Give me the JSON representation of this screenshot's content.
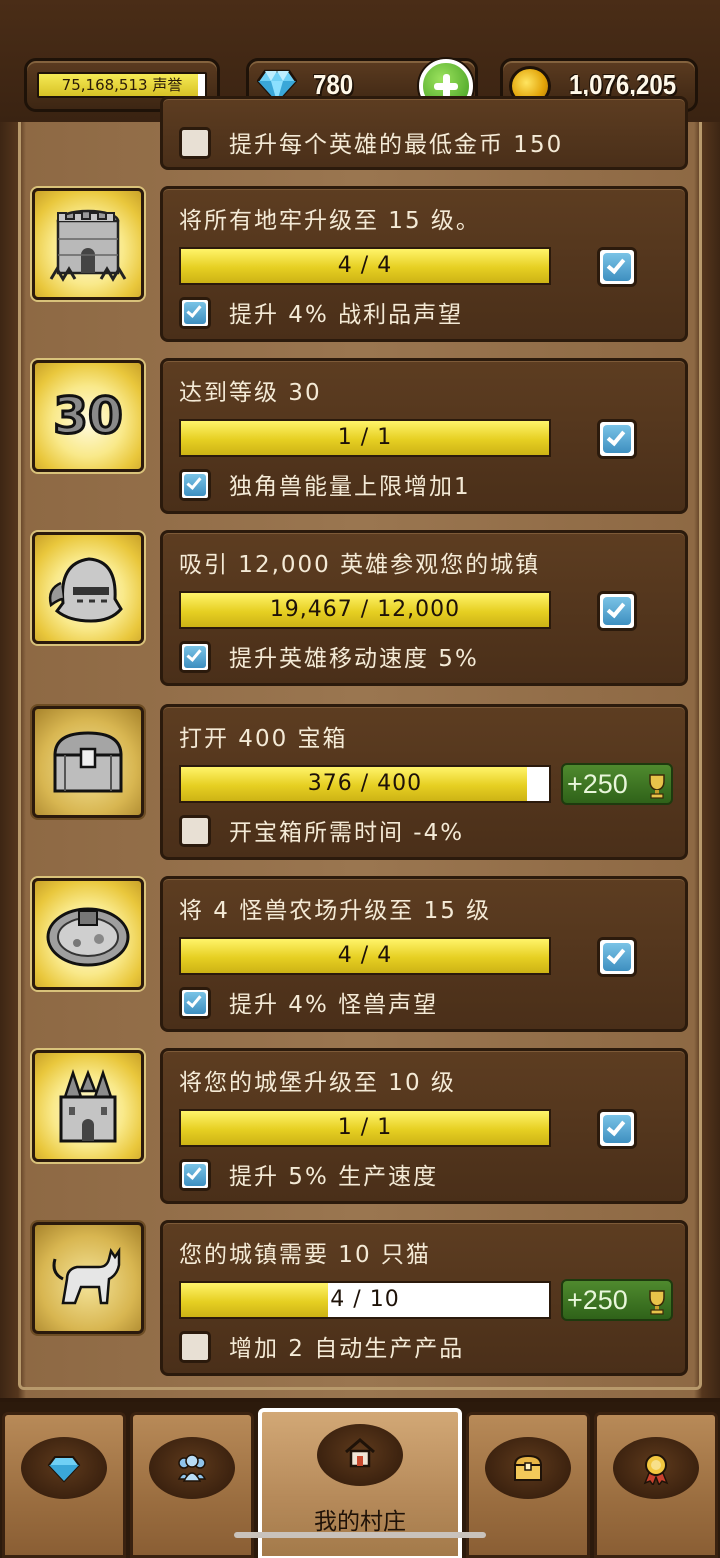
{
  "header": {
    "fame_value": "75,168,513 声誉",
    "gems": "780",
    "gold": "1,076,205",
    "colors": {
      "gem_plus": "#3c9a1c",
      "gold_coin": "#e2a308"
    }
  },
  "partial_top_card": {
    "bonus_text": "提升每个英雄的最低金币 150",
    "bonus_checked": false
  },
  "achievements": [
    {
      "icon": "dungeon-tower-icon",
      "title": "将所有地牢升级至 15 级。",
      "progress_text": "4 / 4",
      "progress_fraction": 1.0,
      "completed": true,
      "bonus_text": "提升 4% 战利品声望",
      "bonus_checked": true
    },
    {
      "icon": "level-30-icon",
      "icon_text": "30",
      "title": "达到等级 30",
      "progress_text": "1 / 1",
      "progress_fraction": 1.0,
      "completed": true,
      "bonus_text": "独角兽能量上限增加1",
      "bonus_checked": true
    },
    {
      "icon": "knight-helmet-icon",
      "title": "吸引 12,000 英雄参观您的城镇",
      "progress_text": "19,467 / 12,000",
      "progress_fraction": 1.0,
      "completed": true,
      "bonus_text": "提升英雄移动速度 5%",
      "bonus_checked": true
    },
    {
      "icon": "treasure-chest-icon",
      "title": "打开 400 宝箱",
      "progress_text": "376 / 400",
      "progress_fraction": 0.94,
      "completed": false,
      "reward": "+250",
      "bonus_text": "开宝箱所需时间 -4%",
      "bonus_checked": false
    },
    {
      "icon": "monster-farm-icon",
      "title": "将 4 怪兽农场升级至 15 级",
      "progress_text": "4 / 4",
      "progress_fraction": 1.0,
      "completed": true,
      "bonus_text": "提升 4% 怪兽声望",
      "bonus_checked": true
    },
    {
      "icon": "castle-icon",
      "title": "将您的城堡升级至 10 级",
      "progress_text": "1 / 1",
      "progress_fraction": 1.0,
      "completed": true,
      "bonus_text": "提升 5% 生产速度",
      "bonus_checked": true
    },
    {
      "icon": "cat-icon",
      "title": "您的城镇需要 10 只猫",
      "progress_text": "4 / 10",
      "progress_fraction": 0.4,
      "completed": false,
      "reward": "+250",
      "bonus_text": "增加 2 自动生产产品",
      "bonus_checked": false
    }
  ],
  "bottom_nav": {
    "tabs": [
      {
        "icon": "gem-icon",
        "label": ""
      },
      {
        "icon": "heroes-icon",
        "label": ""
      },
      {
        "icon": "house-icon",
        "label": "我的村庄",
        "active": true
      },
      {
        "icon": "chest-icon",
        "label": ""
      },
      {
        "icon": "medal-icon",
        "label": ""
      }
    ]
  }
}
